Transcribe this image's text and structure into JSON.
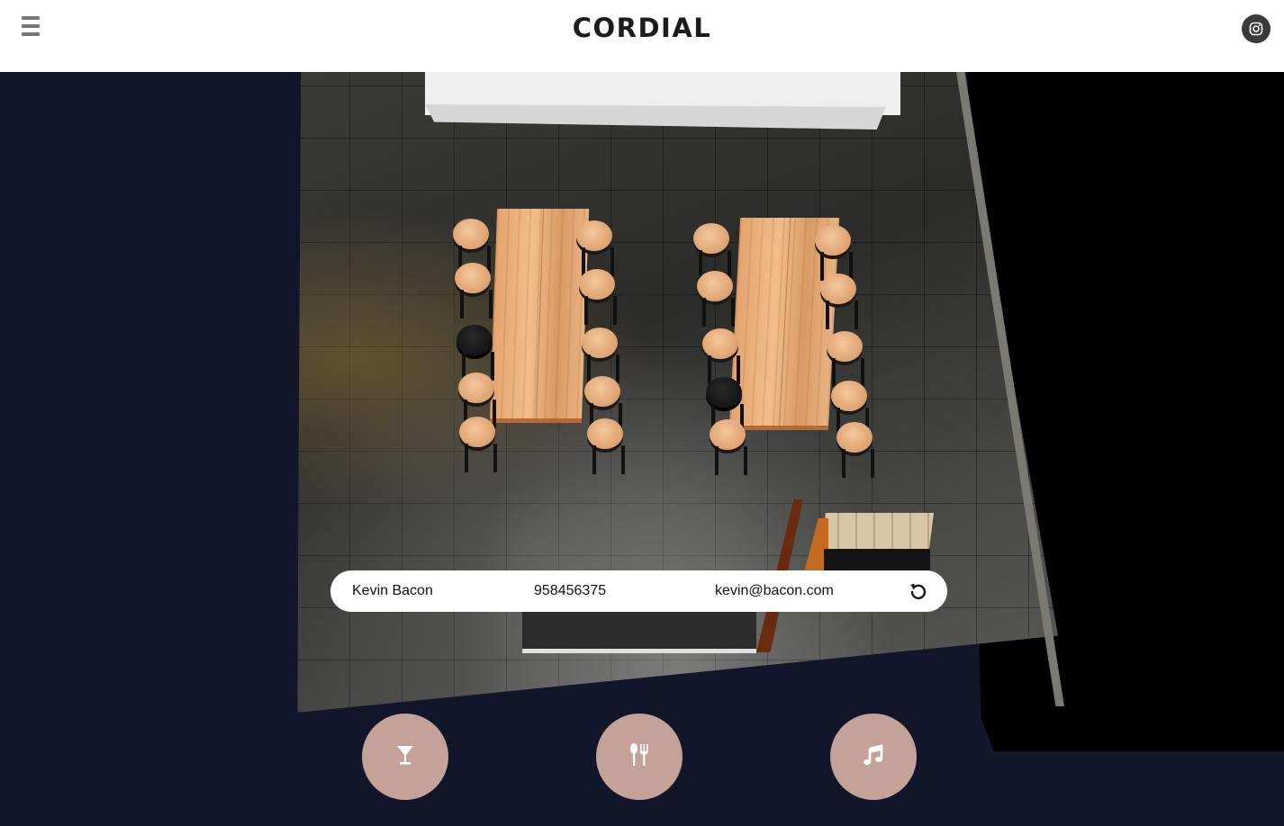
{
  "header": {
    "brand": "CORDIAL",
    "menu_icon": "hamburger-menu-icon",
    "social_icon": "instagram-icon"
  },
  "reservation": {
    "name": "Kevin Bacon",
    "phone": "958456375",
    "email": "kevin@bacon.com",
    "reset_icon": "reset-icon"
  },
  "actions": [
    {
      "icon": "cocktail-icon"
    },
    {
      "icon": "fork-knife-icon"
    },
    {
      "icon": "music-note-icon"
    }
  ],
  "colors": {
    "background": "#11162a",
    "header": "#ffffff",
    "action_button": "#c4a297",
    "instagram_button": "#3a3a3a"
  }
}
